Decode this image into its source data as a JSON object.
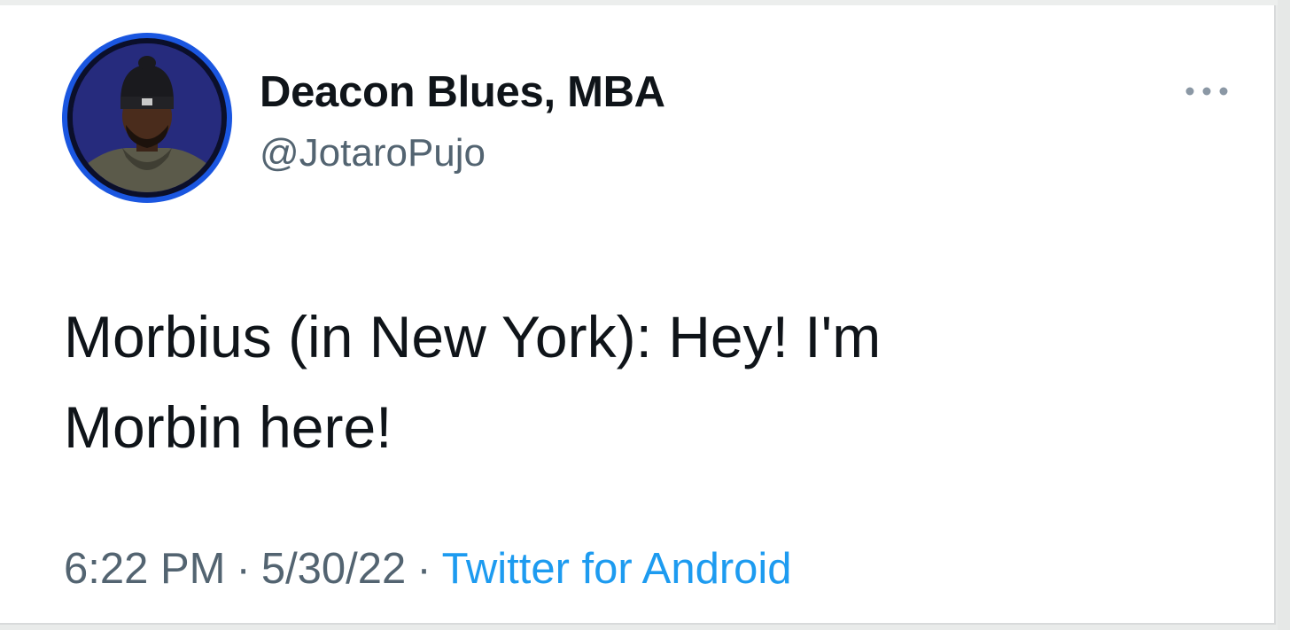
{
  "tweet": {
    "author": {
      "display_name": "Deacon Blues, MBA",
      "handle": "@JotaroPujo"
    },
    "text": "Morbius (in New York): Hey! I'm\nMorbin here!",
    "time": "6:22 PM",
    "separator": "·",
    "date": "5/30/22",
    "source": "Twitter for Android",
    "more_icon": "more-horizontal-icon"
  },
  "colors": {
    "avatar_ring": "#1a56e0",
    "link": "#1d9bf0",
    "secondary_text": "#536471",
    "primary_text": "#0f1419"
  }
}
